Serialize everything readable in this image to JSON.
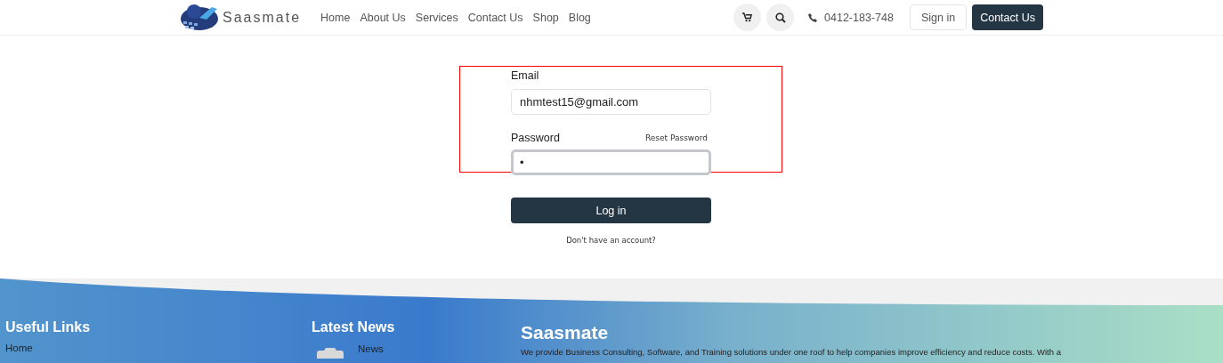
{
  "header": {
    "logo_text": "Saasmate",
    "nav": [
      {
        "label": "Home"
      },
      {
        "label": "About Us"
      },
      {
        "label": "Services"
      },
      {
        "label": "Contact Us"
      },
      {
        "label": "Shop"
      },
      {
        "label": "Blog"
      }
    ],
    "phone": "0412-183-748",
    "sign_in": "Sign in",
    "contact": "Contact Us"
  },
  "login_form": {
    "fields": [
      {
        "label": "Email",
        "value": "nhmtest15@gmail.com",
        "focused": false
      },
      {
        "label": "Password",
        "value": "•",
        "link": "Reset Password",
        "focused": true
      }
    ],
    "submit": "Log in",
    "signup_prompt": "Don't have an account?"
  },
  "footer": {
    "useful_links": {
      "title": "Useful Links",
      "links": [
        "Home"
      ]
    },
    "latest_news": {
      "title": "Latest News",
      "items": [
        {
          "title": "News",
          "kind": "picture"
        }
      ]
    },
    "about": {
      "title": "Saasmate",
      "text": "We provide Business Consulting, Software, and Training solutions under one roof to help companies improve efficiency and reduce costs. With a"
    }
  }
}
